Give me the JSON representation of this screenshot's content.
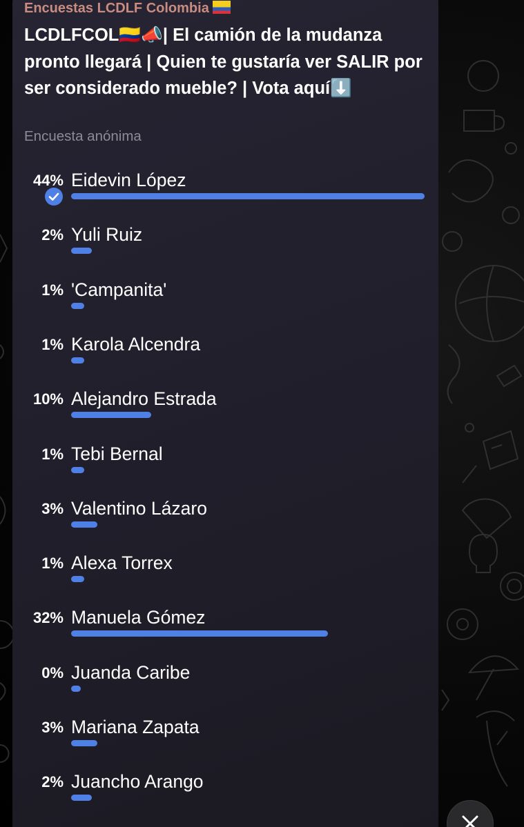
{
  "message": {
    "sender": "Encuestas LCDLF Colombia",
    "question": "LCDLFCOL🇨🇴📣| El camión de la mudanza pronto llegará | Quien te gustaría ver SALIR  por ser considerado mueble? | Vota aquí⬇️",
    "poll_type": "Encuesta anónima"
  },
  "poll": {
    "options": [
      {
        "percent_label": "44%",
        "name": "Eidevin López",
        "percent": 44,
        "voted": true
      },
      {
        "percent_label": "2%",
        "name": "Yuli Ruiz",
        "percent": 2,
        "voted": false
      },
      {
        "percent_label": "1%",
        "name": "'Campanita'",
        "percent": 1,
        "voted": false
      },
      {
        "percent_label": "1%",
        "name": "Karola Alcendra",
        "percent": 1,
        "voted": false
      },
      {
        "percent_label": "10%",
        "name": "Alejandro Estrada",
        "percent": 10,
        "voted": false
      },
      {
        "percent_label": "1%",
        "name": "Tebi Bernal",
        "percent": 1,
        "voted": false
      },
      {
        "percent_label": "3%",
        "name": "Valentino Lázaro",
        "percent": 3,
        "voted": false
      },
      {
        "percent_label": "1%",
        "name": "Alexa Torrex",
        "percent": 1,
        "voted": false
      },
      {
        "percent_label": "32%",
        "name": "Manuela Gómez",
        "percent": 32,
        "voted": false
      },
      {
        "percent_label": "0%",
        "name": "Juanda Caribe",
        "percent": 0,
        "voted": false
      },
      {
        "percent_label": "3%",
        "name": "Mariana Zapata",
        "percent": 3,
        "voted": false
      },
      {
        "percent_label": "2%",
        "name": "Juancho Arango",
        "percent": 2,
        "voted": false
      }
    ]
  },
  "icons": {
    "voted_mark": "checkmark-circle-icon",
    "close": "close-icon",
    "flag": "colombia-flag-icon"
  },
  "colors": {
    "accent": "#4f80e6",
    "sender": "#c98c80",
    "bubble": "#221f2b",
    "muted_text": "#8d8b95"
  }
}
